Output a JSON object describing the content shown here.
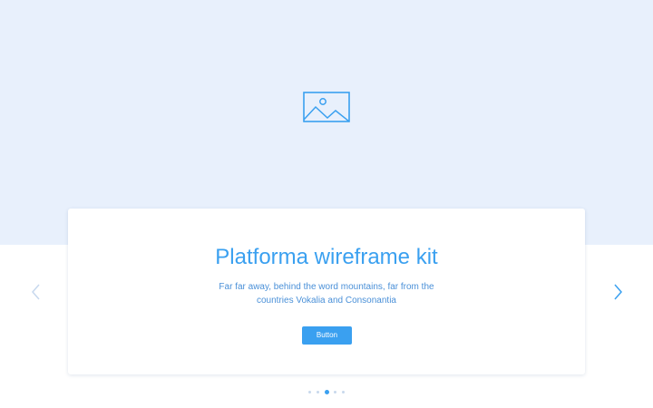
{
  "hero": {
    "image_icon": "image-placeholder-icon",
    "background": "#e8f0fc"
  },
  "card": {
    "title": "Platforma wireframe kit",
    "text": "Far far away, behind the word mountains, far from the countries Vokalia and Consonantia",
    "button_label": "Button"
  },
  "navigation": {
    "prev_icon": "chevron-left-icon",
    "next_icon": "chevron-right-icon"
  },
  "pagination": {
    "total": 5,
    "active_index": 2
  },
  "colors": {
    "accent": "#3aa0f0",
    "text": "#4a90d8",
    "arrow_inactive": "#c7d8ee"
  }
}
